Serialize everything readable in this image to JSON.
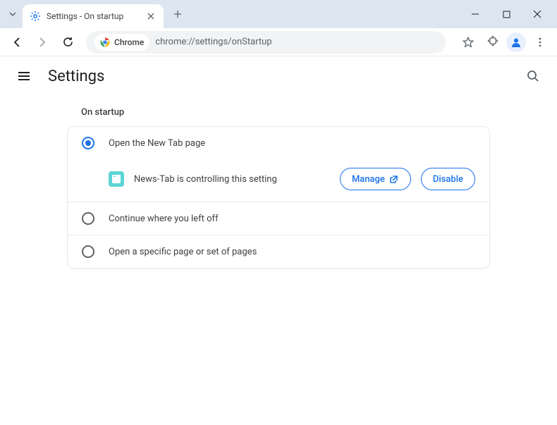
{
  "window": {
    "tab_title": "Settings - On startup"
  },
  "toolbar": {
    "chrome_label": "Chrome",
    "url": "chrome://settings/onStartup"
  },
  "header": {
    "title": "Settings"
  },
  "section": {
    "title": "On startup",
    "options": [
      {
        "label": "Open the New Tab page",
        "selected": true
      },
      {
        "label": "Continue where you left off",
        "selected": false
      },
      {
        "label": "Open a specific page or set of pages",
        "selected": false
      }
    ],
    "extension": {
      "name_message": "News-Tab is controlling this setting",
      "manage_label": "Manage",
      "disable_label": "Disable"
    }
  }
}
